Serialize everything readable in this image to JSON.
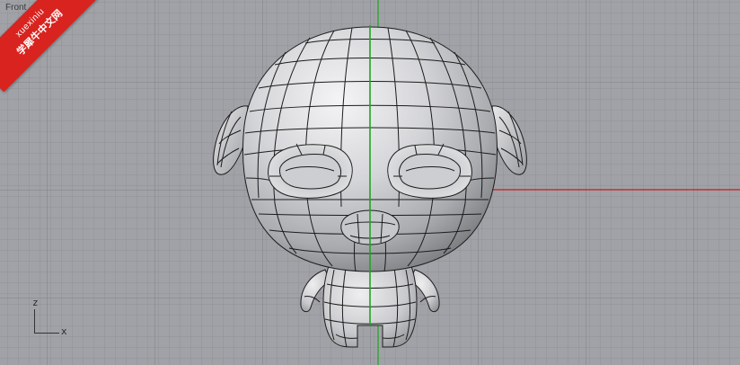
{
  "viewport": {
    "label": "Front",
    "background_color": "#a0a2a7",
    "grid_color": "#8e9095",
    "grid_major_color": "#7b7d82",
    "axis_y_color": "#1ea51e",
    "axis_x_color": "#c41e1e"
  },
  "axes": {
    "z_label": "z",
    "x_label": "x"
  },
  "watermark": {
    "top_text": "xuexiniu",
    "bottom_text": "学犀牛中文网",
    "color": "#d8231f"
  },
  "model": {
    "name": "cartoon-character",
    "surface_color": "#d2d3d6",
    "wire_color": "#1c1c1c"
  }
}
